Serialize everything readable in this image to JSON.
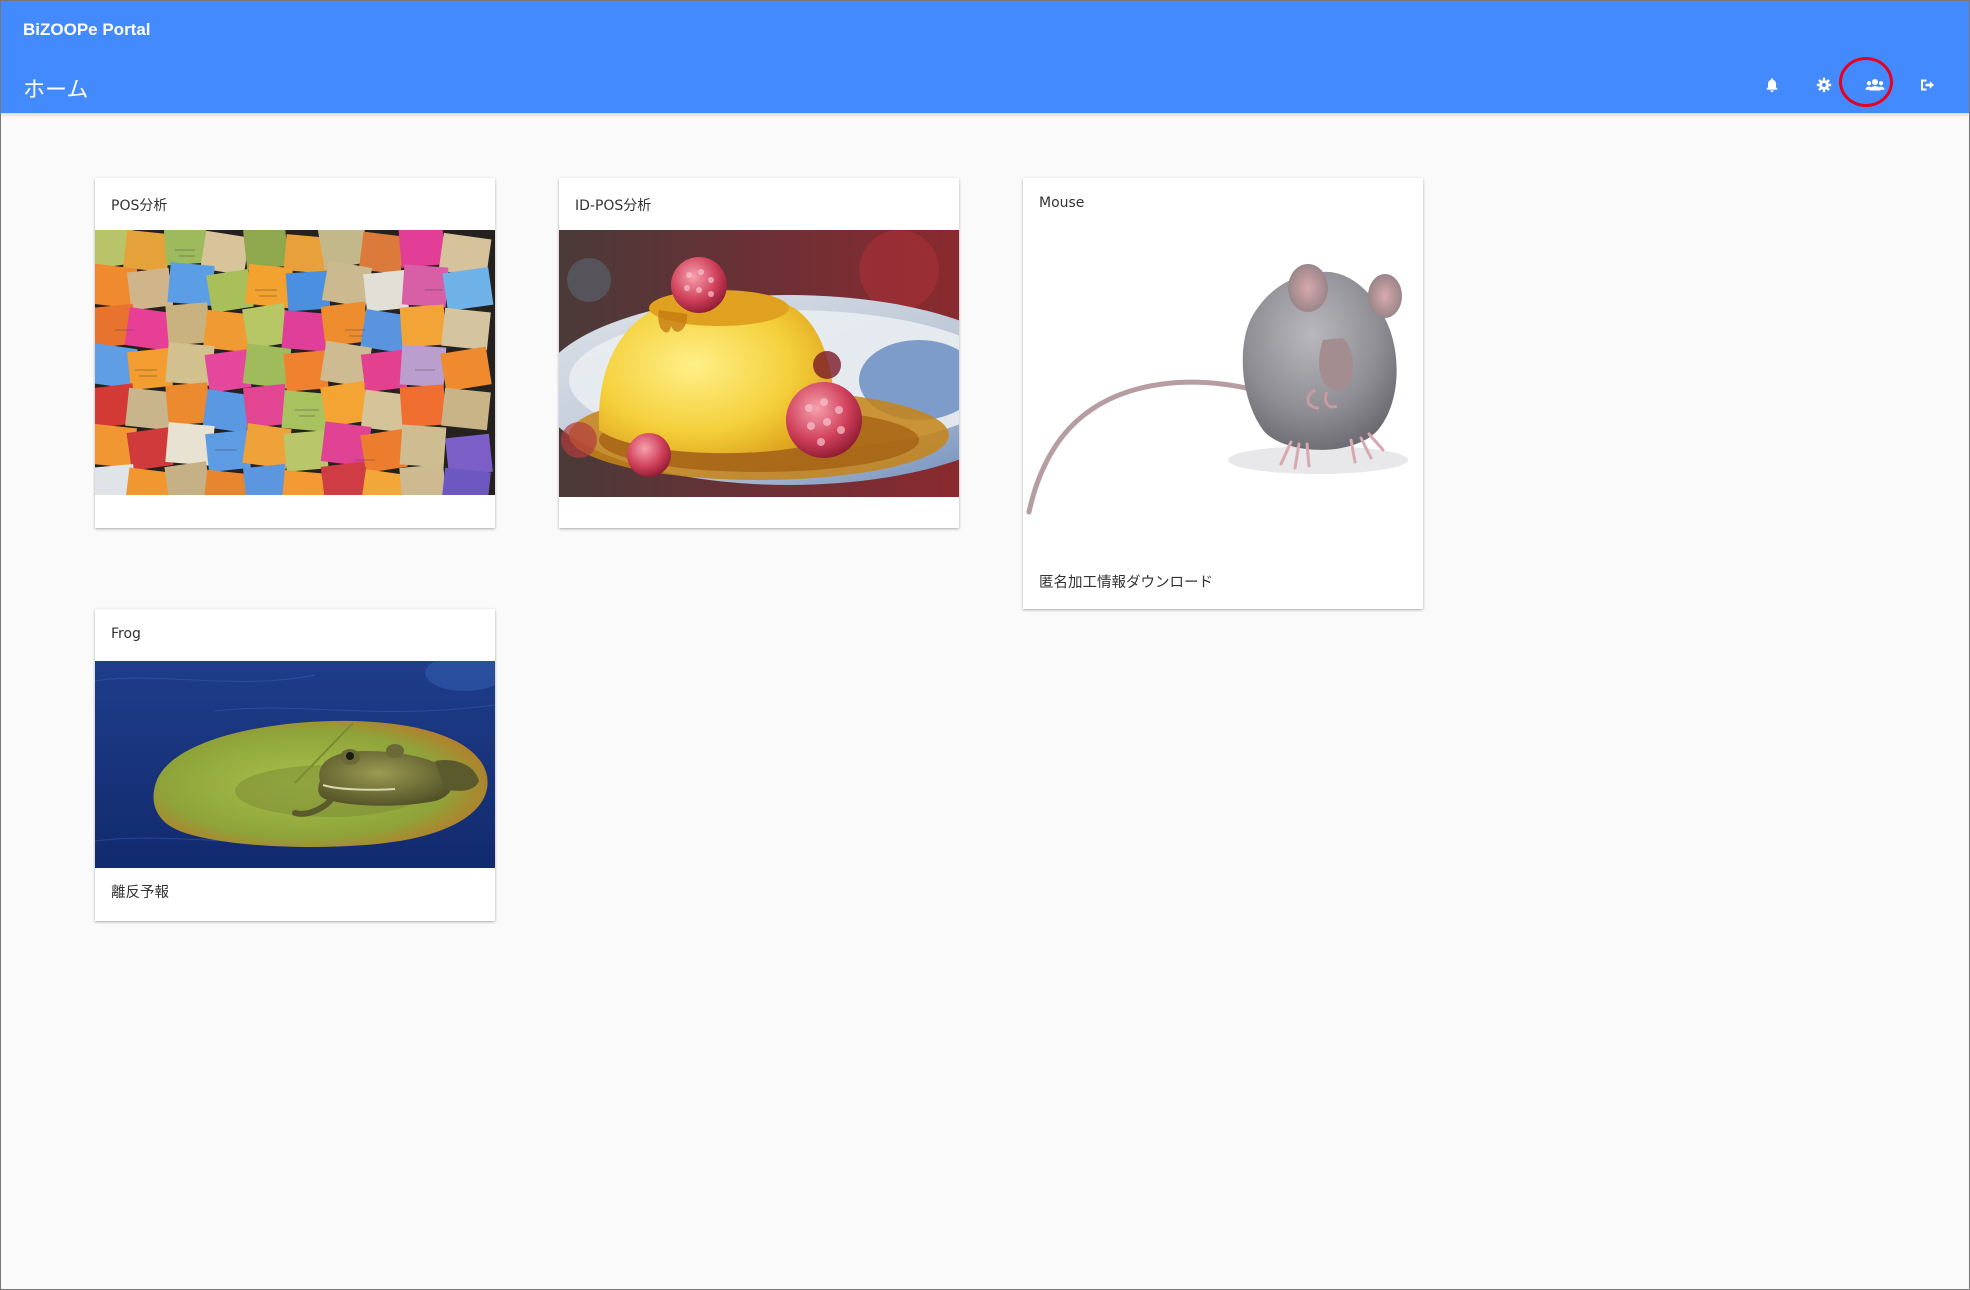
{
  "app": {
    "name": "BiZOOPe Portal"
  },
  "header": {
    "title": "ホーム",
    "accent_color": "#448aff",
    "icons": [
      "bell-icon",
      "gear-icon",
      "users-icon",
      "logout-icon"
    ],
    "highlight_color": "#e8001c"
  },
  "cards": [
    {
      "title": "POS分析",
      "image": "sticky-notes-image",
      "footer": ""
    },
    {
      "title": "ID-POS分析",
      "image": "pudding-raspberry-image",
      "footer": ""
    },
    {
      "title": "Mouse",
      "image": "mouse-image",
      "footer": "匿名加工情報ダウンロード"
    },
    {
      "title": "Frog",
      "image": "frog-lily-pad-image",
      "footer": "離反予報"
    }
  ]
}
